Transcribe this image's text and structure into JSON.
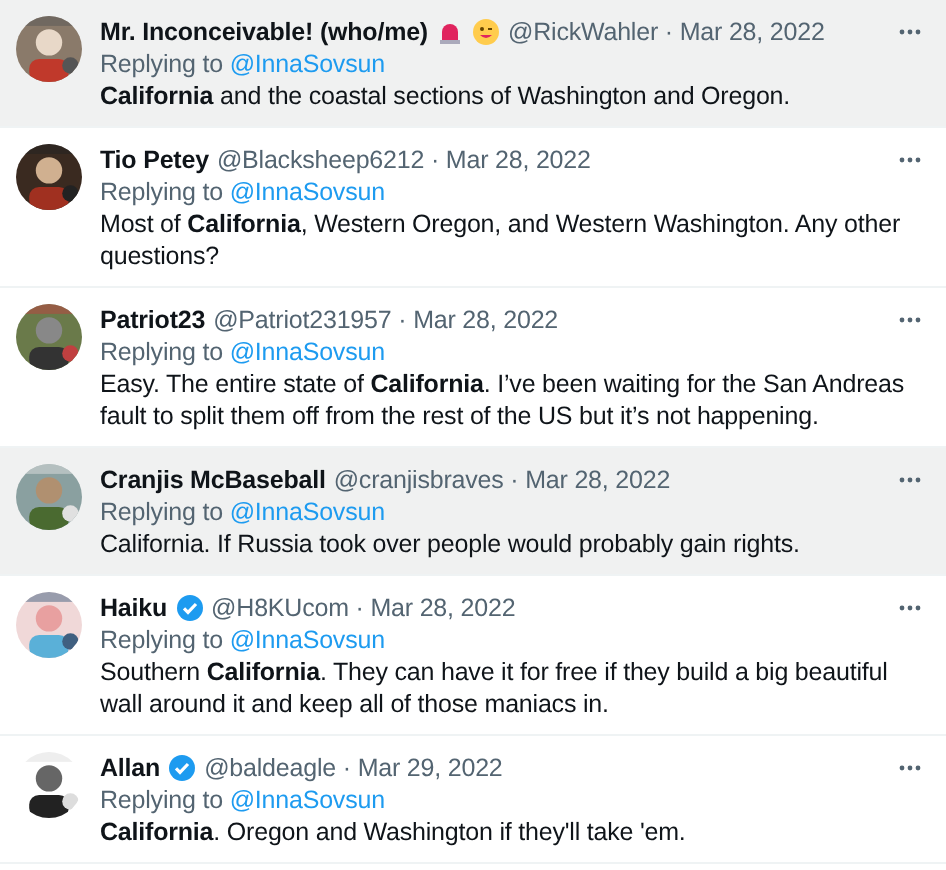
{
  "replies": [
    {
      "name": "Mr. Inconceivable! (who/me)",
      "name_emoji": true,
      "verified": false,
      "handle": "@RickWahler",
      "separator": "·",
      "date": "Mar 28, 2022",
      "replying_label": "Replying to",
      "replying_to": "@InnaSovsun",
      "text": "**California** and the coastal sections of Washington and Oregon.",
      "highlighted": true
    },
    {
      "name": "Tio Petey",
      "name_emoji": false,
      "verified": false,
      "handle": "@Blacksheep6212",
      "separator": "·",
      "date": "Mar 28, 2022",
      "replying_label": "Replying to",
      "replying_to": "@InnaSovsun",
      "text": "Most of **California**, Western Oregon, and Western Washington. Any other questions?",
      "highlighted": false
    },
    {
      "name": "Patriot23",
      "name_emoji": false,
      "verified": false,
      "handle": "@Patriot231957",
      "separator": "·",
      "date": "Mar 28, 2022",
      "replying_label": "Replying to",
      "replying_to": "@InnaSovsun",
      "text": "Easy. The entire state of **California**. I’ve been waiting for the San Andreas fault to split them off from the rest of the US but it’s not happening.",
      "highlighted": false
    },
    {
      "name": "Cranjis McBaseball",
      "name_emoji": false,
      "verified": false,
      "handle": "@cranjisbraves",
      "separator": "·",
      "date": "Mar 28, 2022",
      "replying_label": "Replying to",
      "replying_to": "@InnaSovsun",
      "text": "California. If Russia took over people would probably gain rights.",
      "highlighted": true
    },
    {
      "name": "Haiku",
      "name_emoji": false,
      "verified": true,
      "handle": "@H8KUcom",
      "separator": "·",
      "date": "Mar 28, 2022",
      "replying_label": "Replying to",
      "replying_to": "@InnaSovsun",
      "text": "Southern **California**. They can have it for free if they build a big beautiful wall around it and keep all of those maniacs in.",
      "highlighted": false
    },
    {
      "name": "Allan",
      "name_emoji": false,
      "verified": true,
      "handle": "@baldeagle",
      "separator": "·",
      "date": "Mar 29, 2022",
      "replying_label": "Replying to",
      "replying_to": "@InnaSovsun",
      "text": "**California**. Oregon and Washington if they'll take 'em.",
      "highlighted": false
    }
  ]
}
